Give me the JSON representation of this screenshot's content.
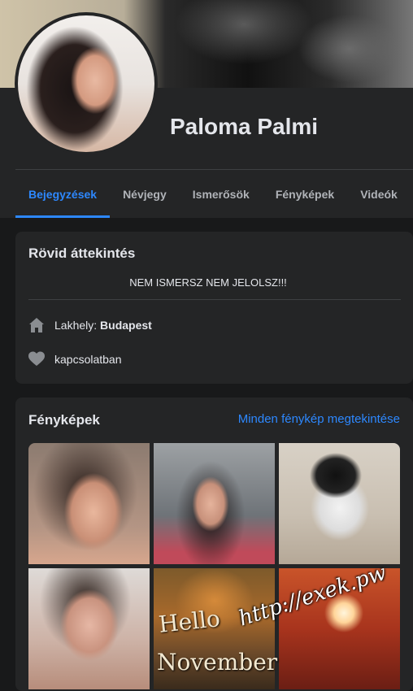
{
  "profile": {
    "name": "Paloma Palmi"
  },
  "tabs": [
    {
      "label": "Bejegyzések",
      "active": true
    },
    {
      "label": "Névjegy",
      "active": false
    },
    {
      "label": "Ismerősök",
      "active": false
    },
    {
      "label": "Fényképek",
      "active": false
    },
    {
      "label": "Videók",
      "active": false
    }
  ],
  "intro": {
    "title": "Rövid áttekintés",
    "bio": "NEM ISMERSZ NEM JELOLSZ!!!",
    "lives_label": "Lakhely: ",
    "lives_city": "Budapest",
    "lives_icon": "home-icon",
    "relationship": "kapcsolatban",
    "relationship_icon": "heart-icon"
  },
  "photos": {
    "title": "Fényképek",
    "see_all": "Minden fénykép megtekintése",
    "overlay_hello": "Hello",
    "overlay_november": "November",
    "watermark": "http://exek.pw"
  },
  "colors": {
    "accent": "#2d88ff",
    "card": "#242526",
    "background": "#18191a",
    "text": "#e4e6eb",
    "muted": "#b0b3b8"
  }
}
